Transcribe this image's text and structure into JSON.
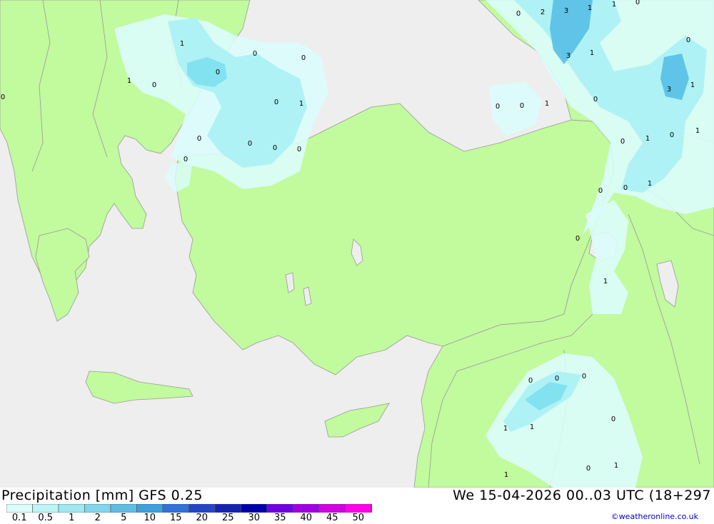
{
  "title": "Precipitation [mm] GFS 0.25",
  "valid_time": "We 15-04-2026 00..03 UTC (18+297",
  "credit": "©weatheronline.co.uk",
  "colors": {
    "land": "#c2fa9e",
    "sea": "#eeeeee",
    "border": "#999999",
    "rain_light": "#dcfcfc",
    "rain_1": "#a9f1f5",
    "rain_2": "#7fe0ef",
    "rain_5": "#56bfe6"
  },
  "legend": {
    "labels": [
      "0.1",
      "0.5",
      "1",
      "2",
      "5",
      "10",
      "15",
      "20",
      "25",
      "30",
      "35",
      "40",
      "45",
      "50"
    ],
    "colors": [
      "#dcfcfc",
      "#bdf4f6",
      "#9fe8f2",
      "#7ed7ec",
      "#5dbde4",
      "#3f9fde",
      "#2f72d8",
      "#2346c8",
      "#1623b0",
      "#0000a8",
      "#7000dc",
      "#a000e0",
      "#d000e0",
      "#ff00e8",
      "#c000b0"
    ]
  },
  "map_values": [
    "0",
    "2",
    "3",
    "1",
    "1",
    "0",
    "1",
    "0",
    "0",
    "1",
    "0",
    "3",
    "1",
    "0",
    "3",
    "1",
    "0",
    "1",
    "0",
    "0",
    "1",
    "0",
    "0",
    "0",
    "0",
    "0",
    "1",
    "0",
    "1",
    "1",
    "0",
    "0",
    "0",
    "1",
    "0",
    "0",
    "0",
    "0",
    "1",
    "1",
    "0",
    "1",
    "0",
    "1",
    "0",
    "0",
    "0"
  ]
}
